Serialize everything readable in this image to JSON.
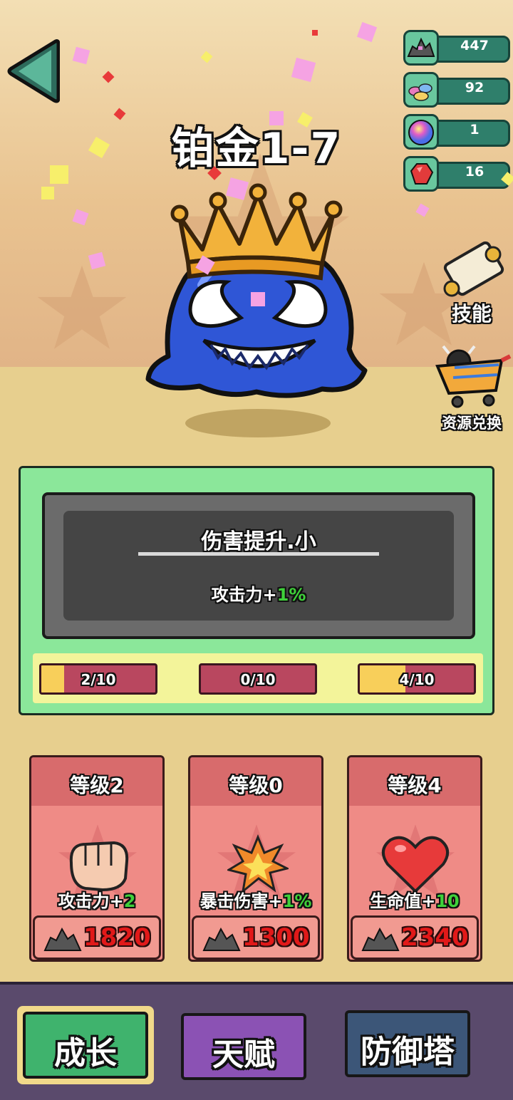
{
  "stage_title": "铂金1-7",
  "resources": [
    {
      "icon": "stone-pile-icon",
      "value": "447"
    },
    {
      "icon": "gems-icon",
      "value": "92"
    },
    {
      "icon": "rainbow-orb-icon",
      "value": "1"
    },
    {
      "icon": "red-gem-icon",
      "value": "16"
    }
  ],
  "side_buttons": {
    "skills_label": "技能",
    "exchange_label": "资源兑换"
  },
  "skill_panel": {
    "name": "伤害提升.小",
    "desc_prefix": "攻击力+",
    "desc_value": "1%",
    "progress": [
      {
        "text": "2/10",
        "fraction": 0.2
      },
      {
        "text": "0/10",
        "fraction": 0.0
      },
      {
        "text": "4/10",
        "fraction": 0.4
      }
    ]
  },
  "upgrade_cards": [
    {
      "level": "等级2",
      "stat_prefix": "攻击力+",
      "stat_value": "2",
      "price": "1820",
      "icon": "fist-icon"
    },
    {
      "level": "等级0",
      "stat_prefix": "暴击伤害+",
      "stat_value": "1%",
      "price": "1300",
      "icon": "explosion-icon"
    },
    {
      "level": "等级4",
      "stat_prefix": "生命值+",
      "stat_value": "10",
      "price": "2340",
      "icon": "heart-icon"
    }
  ],
  "bottom_nav": {
    "growth": "成长",
    "talent": "天赋",
    "tower": "防御塔"
  },
  "colors": {
    "panel_green": "#8be79a",
    "card_red": "#ef8b86",
    "price_red": "#e11919",
    "progress_yellow": "#f8cf5a",
    "nav_growth": "#3fb36d",
    "nav_talent": "#8b52b4",
    "nav_tower": "#3c5678"
  }
}
